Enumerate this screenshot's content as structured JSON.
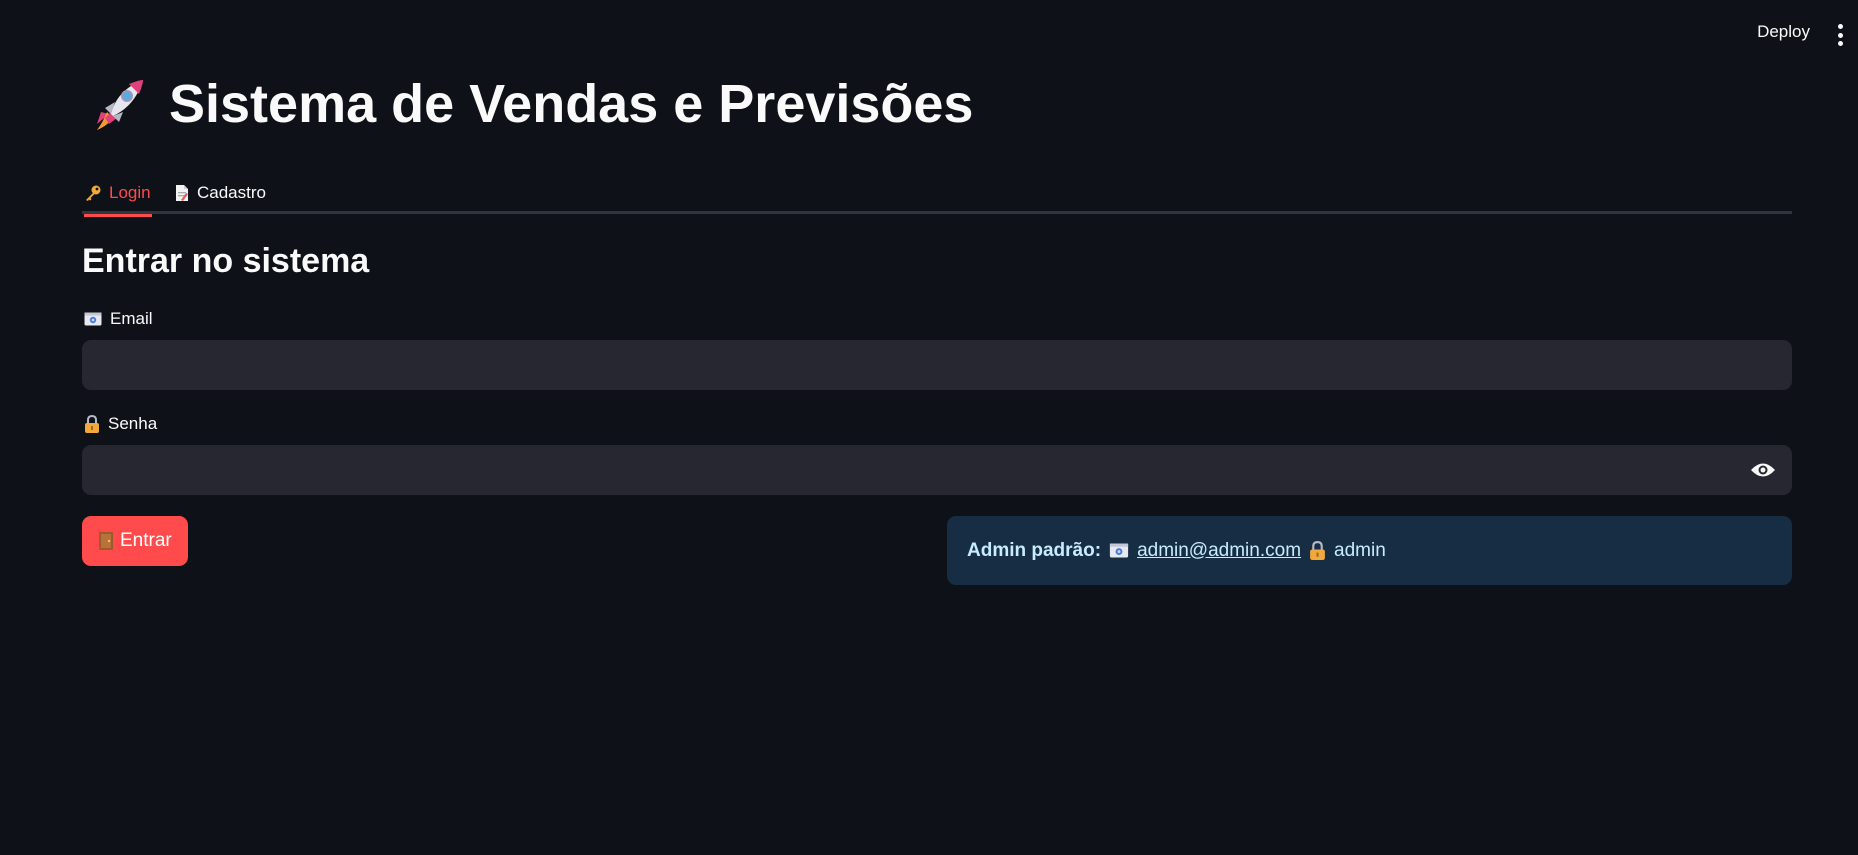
{
  "header": {
    "deploy_label": "Deploy",
    "menu_icon": "kebab-menu-icon"
  },
  "app": {
    "title": "Sistema de Vendas e Previsões",
    "title_icon": "rocket-icon"
  },
  "tabs": [
    {
      "label": "Login",
      "icon": "key-icon",
      "active": true
    },
    {
      "label": "Cadastro",
      "icon": "document-icon",
      "active": false
    }
  ],
  "login": {
    "subheader": "Entrar no sistema",
    "email_label": "Email",
    "email_icon": "id-card-icon",
    "email_value": "",
    "senha_label": "Senha",
    "senha_icon": "lock-icon",
    "senha_value": "",
    "show_password_icon": "eye-icon",
    "submit_label": "Entrar",
    "submit_icon": "door-icon"
  },
  "info": {
    "prefix": "Admin padrão:",
    "email": "admin@admin.com",
    "password": "admin"
  },
  "colors": {
    "background": "#0e1117",
    "accent": "#ff4b4b",
    "input_bg": "#262730",
    "info_bg": "#172d43",
    "info_text": "#c7ebff"
  }
}
